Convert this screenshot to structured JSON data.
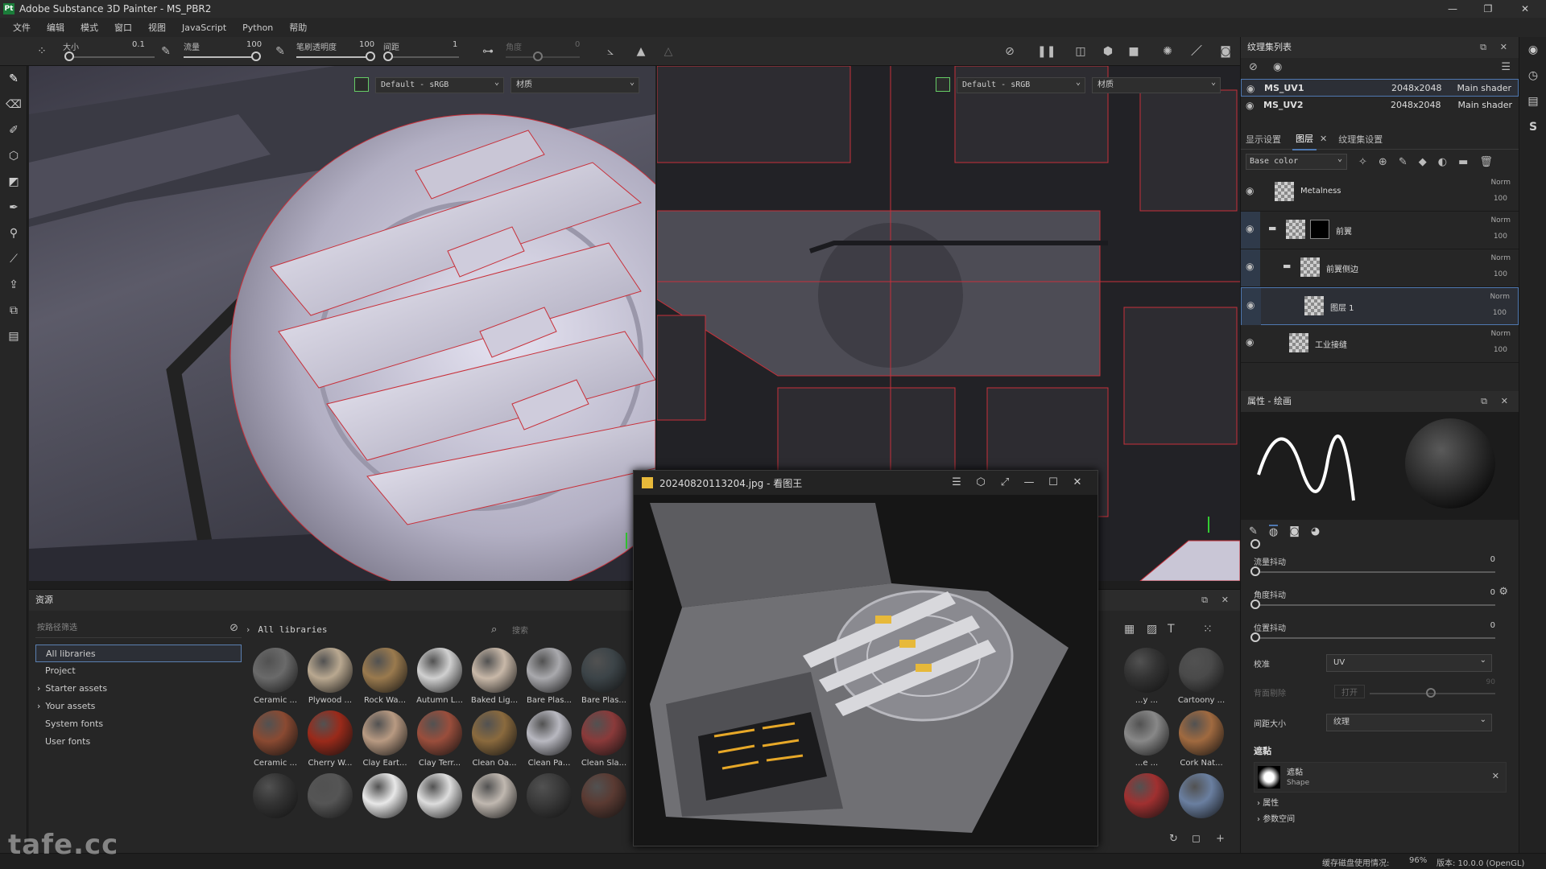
{
  "window": {
    "title": "Adobe Substance 3D Painter - MS_PBR2",
    "app_badge": "Pt"
  },
  "menu": [
    "文件",
    "编辑",
    "模式",
    "窗口",
    "视图",
    "JavaScript",
    "Python",
    "帮助"
  ],
  "tool_properties": {
    "size_label": "大小",
    "size_value": "0.1",
    "flow_label": "流量",
    "flow_value": "100",
    "stroke_opacity_label": "笔刷透明度",
    "stroke_opacity_value": "100",
    "spacing_label": "间距",
    "spacing_value": "1",
    "angle_label": "角度",
    "angle_value": "0"
  },
  "viewport_3d": {
    "colorspace": "Default - sRGB",
    "mode": "材质"
  },
  "viewport_2d": {
    "colorspace": "Default - sRGB",
    "mode": "材质"
  },
  "image_viewer": {
    "title": "20240820113204.jpg - 看图王"
  },
  "assets": {
    "panel_title": "资源",
    "filter_placeholder": "按路径筛选",
    "breadcrumb": "All libraries",
    "search_placeholder": "搜索",
    "libraries": [
      {
        "label": "All libraries",
        "selected": true,
        "expandable": false
      },
      {
        "label": "Project",
        "selected": false,
        "expandable": false
      },
      {
        "label": "Starter assets",
        "selected": false,
        "expandable": true
      },
      {
        "label": "Your assets",
        "selected": false,
        "expandable": true
      },
      {
        "label": "System fonts",
        "selected": false,
        "expandable": false
      },
      {
        "label": "User fonts",
        "selected": false,
        "expandable": false
      }
    ],
    "row1_labels": [
      "Ceramic ...",
      "Plywood ...",
      "Rock Wa...",
      "Autumn L...",
      "Baked Lig...",
      "Bare Plas...",
      "Bare Plas..."
    ],
    "row2_labels": [
      "Ceramic ...",
      "Cherry W...",
      "Clay Eart...",
      "Clay Terr...",
      "Clean Oa...",
      "Clean Pa...",
      "Clean Sla..."
    ],
    "right_labels_row1": [
      "...y ...",
      "Cartoony ..."
    ],
    "right_labels_row2": [
      "...e ...",
      "Cork Nat..."
    ]
  },
  "texture_sets": {
    "panel_title": "纹理集列表",
    "items": [
      {
        "name": "MS_UV1",
        "resolution": "2048x2048",
        "shader": "Main shader",
        "selected": true
      },
      {
        "name": "MS_UV2",
        "resolution": "2048x2048",
        "shader": "Main shader",
        "selected": false
      }
    ]
  },
  "layer_tabs": [
    "显示设置",
    "图层",
    "纹理集设置"
  ],
  "channel": "Base color",
  "layers": [
    {
      "name": "Metalness",
      "blend": "Norm",
      "opacity": "100",
      "indent": 0,
      "folder": false,
      "selected": false
    },
    {
      "name": "前翼",
      "blend": "Norm",
      "opacity": "100",
      "indent": 0,
      "folder": true,
      "selected": false
    },
    {
      "name": "前翼侧边",
      "blend": "Norm",
      "opacity": "100",
      "indent": 1,
      "folder": true,
      "selected": false
    },
    {
      "name": "图层 1",
      "blend": "Norm",
      "opacity": "100",
      "indent": 2,
      "folder": false,
      "selected": true
    },
    {
      "name": "工业接缝",
      "blend": "Norm",
      "opacity": "100",
      "indent": 1,
      "folder": false,
      "selected": false
    }
  ],
  "properties": {
    "panel_title": "属性 - 绘画",
    "sliders": [
      {
        "label": "流量抖动",
        "value": "0"
      },
      {
        "label": "角度抖动",
        "value": "0"
      },
      {
        "label": "位置抖动",
        "value": "0"
      }
    ],
    "alignment_label": "校准",
    "alignment_value": "UV",
    "backface_label": "背面剔除",
    "backface_value": "打开",
    "backface_number": "90",
    "spacing_size_label": "间距大小",
    "spacing_size_value": "纹理",
    "stencil_section": "遮黏",
    "stencil_name": "遮黏",
    "stencil_type": "Shape",
    "attributes_label": "属性",
    "more_label": "参数空间"
  },
  "status": {
    "disk_label": "缓存磁盘使用情况:",
    "disk_value": "96%",
    "version": "版本: 10.0.0 (OpenGL)"
  },
  "watermark": "tafe.cc",
  "colors": {
    "selection": "#4f78b0",
    "seam": "#c8303a",
    "accent_green": "#1b7d3a"
  }
}
